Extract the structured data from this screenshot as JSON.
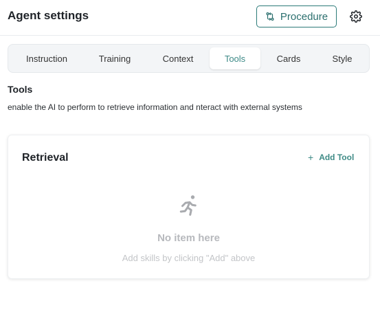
{
  "header": {
    "title": "Agent settings",
    "procedure_label": "Procedure",
    "procedure_icon": "git-compare-icon",
    "settings_icon": "gear-icon"
  },
  "tabs": [
    {
      "label": "Instruction",
      "active": false
    },
    {
      "label": "Training",
      "active": false
    },
    {
      "label": "Context",
      "active": false
    },
    {
      "label": "Tools",
      "active": true
    },
    {
      "label": "Cards",
      "active": false
    },
    {
      "label": "Style",
      "active": false
    }
  ],
  "section": {
    "title": "Tools",
    "description": "enable the AI to perform to retrieve information and nteract with external systems"
  },
  "retrieval": {
    "title": "Retrieval",
    "add_label": "Add Tool",
    "add_icon": "plus-icon",
    "empty_icon": "running-person-icon",
    "empty_title": "No item here",
    "empty_subtitle": "Add skills by clicking \"Add\" above"
  },
  "colors": {
    "accent": "#3d8a87",
    "border": "#e9ecef",
    "muted": "#b7b9bd"
  }
}
